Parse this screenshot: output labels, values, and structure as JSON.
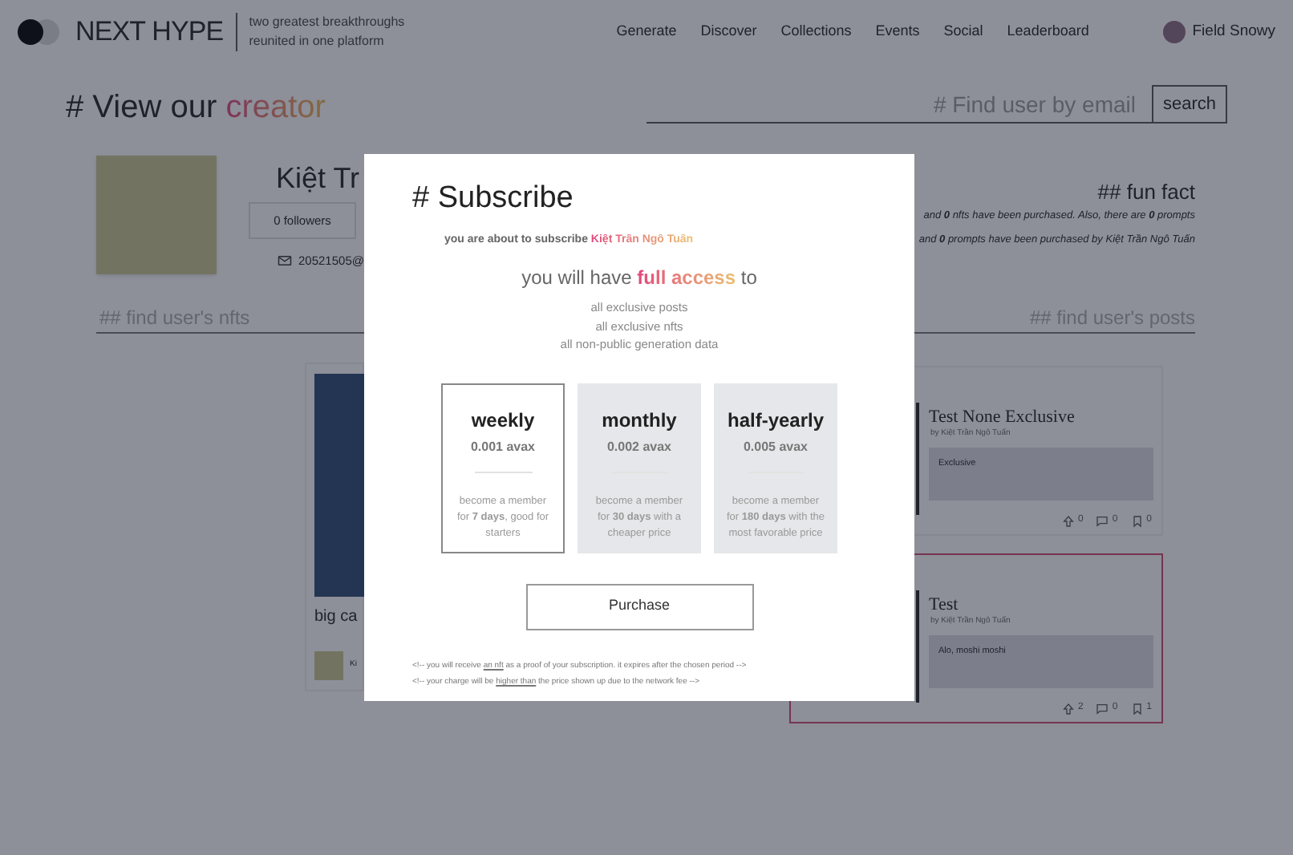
{
  "brand": {
    "name": "NEXT HYPE",
    "tagline_lines": [
      "two greatest breakthroughs",
      "reunited in one platform"
    ]
  },
  "nav": [
    {
      "label": "Generate"
    },
    {
      "label": "Discover"
    },
    {
      "label": "Collections"
    },
    {
      "label": "Events"
    },
    {
      "label": "Social"
    },
    {
      "label": "Leaderboard"
    }
  ],
  "user": {
    "name": "Field Snowy"
  },
  "heading": {
    "prefix": "# View our ",
    "highlight": "creator"
  },
  "search": {
    "placeholder": "# Find user by email",
    "button": "search"
  },
  "profile": {
    "name": "Kiệt Tr",
    "followers": "0 followers",
    "email": "20521505@"
  },
  "fun_fact": {
    "title": "## fun fact",
    "lines": [
      "and **0** nfts have been purchased. Also, there are **0** prompts",
      "and **0** prompts have been purchased by Kiệt Trần Ngô Tuấn"
    ]
  },
  "nfts_heading": "## find user's nfts",
  "posts_heading": "## find user's posts",
  "nft_card": {
    "title": "big ca",
    "owner": "Ki"
  },
  "posts": [
    {
      "title": "Test None Exclusive",
      "author": "by Kiệt Trần Ngô Tuấn",
      "content": "Exclusive",
      "upvotes": "0",
      "comments": "0",
      "bookmarks": "0",
      "highlighted": false
    },
    {
      "title": "Test",
      "author": "by Kiệt Trần Ngô Tuấn",
      "content": "Alo, moshi moshi",
      "upvotes": "2",
      "comments": "0",
      "bookmarks": "1",
      "highlighted": true
    }
  ],
  "modal": {
    "title": "# Subscribe",
    "intro": "you are about to subscribe ",
    "creator": "Kiệt Trần Ngô Tuấn",
    "access_prefix": "you will have ",
    "access_highlight": "full access",
    "access_suffix": " to",
    "perks": [
      "all exclusive posts",
      "all exclusive nfts",
      "all non-public generation data"
    ],
    "plans": [
      {
        "name": "weekly",
        "price": "0.001 avax",
        "description": "become a member for **7 days**, good for starters",
        "selected": true
      },
      {
        "name": "monthly",
        "price": "0.002 avax",
        "description": "become a member for **30 days** with a cheaper price",
        "selected": false
      },
      {
        "name": "half-yearly",
        "price": "0.005 avax",
        "description": "become a member for **180 days** with the most favorable price",
        "selected": false
      }
    ],
    "button": "Purchase",
    "notes": [
      [
        {
          "text": "<!-- you will receive ",
          "underline": false
        },
        {
          "text": "an nft",
          "underline": true
        },
        {
          "text": " as a proof of your subscription. it expires after the chosen period -->",
          "underline": false
        }
      ],
      [
        {
          "text": "<!-- your charge will be ",
          "underline": false
        },
        {
          "text": "higher than",
          "underline": true
        },
        {
          "text": " the price shown up due to the network fee -->",
          "underline": false
        }
      ]
    ]
  }
}
